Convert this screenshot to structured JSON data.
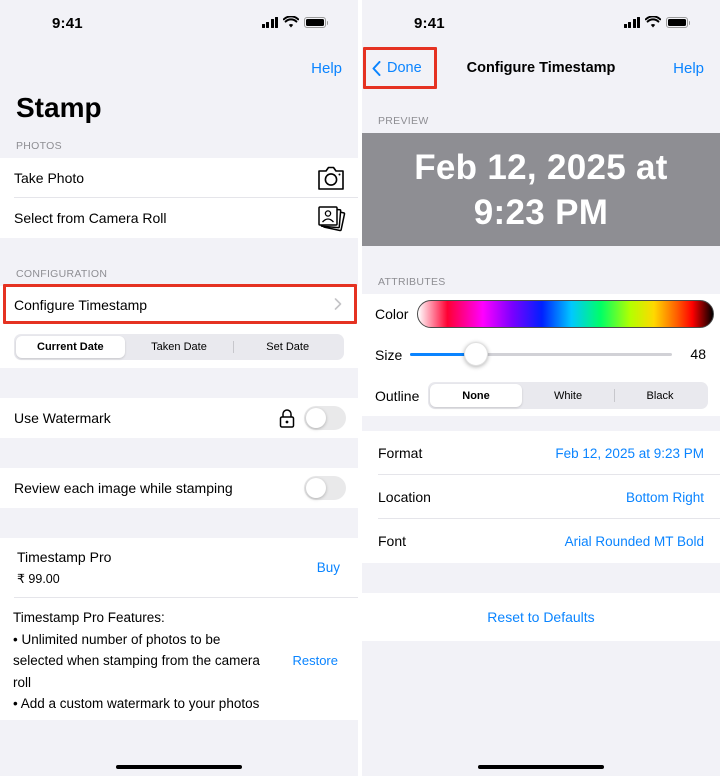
{
  "status": {
    "time": "9:41"
  },
  "left": {
    "help": "Help",
    "title": "Stamp",
    "photos_header": "PHOTOS",
    "take_photo": "Take Photo",
    "camera_roll": "Select from Camera Roll",
    "config_header": "CONFIGURATION",
    "configure_timestamp": "Configure Timestamp",
    "date_modes": [
      "Current Date",
      "Taken Date",
      "Set Date"
    ],
    "use_watermark": "Use Watermark",
    "review_images": "Review each image while stamping",
    "pro_title": "Timestamp Pro",
    "pro_price": "₹ 99.00",
    "buy": "Buy",
    "features_title": "Timestamp Pro Features:",
    "feature_1_a": "• Unlimited number of photos to be",
    "feature_1_b": "selected when stamping from the camera",
    "feature_1_c": "roll",
    "feature_2": "• Add a custom watermark to your photos",
    "restore": "Restore"
  },
  "right": {
    "done": "Done",
    "nav_title": "Configure Timestamp",
    "help": "Help",
    "preview_header": "PREVIEW",
    "preview_line1": "Feb 12, 2025 at",
    "preview_line2": "9:23 PM",
    "attributes_header": "ATTRIBUTES",
    "color_label": "Color",
    "size_label": "Size",
    "size_value": "48",
    "size_level": 0.25,
    "outline_label": "Outline",
    "outline_options": [
      "None",
      "White",
      "Black"
    ],
    "format_label": "Format",
    "format_value": "Feb 12, 2025 at 9:23 PM",
    "location_label": "Location",
    "location_value": "Bottom Right",
    "font_label": "Font",
    "font_value": "Arial Rounded MT Bold",
    "reset": "Reset to Defaults"
  },
  "colors": {
    "accent": "#0a84ff",
    "highlight": "#e53222",
    "preview_bg": "#8e8e93"
  }
}
